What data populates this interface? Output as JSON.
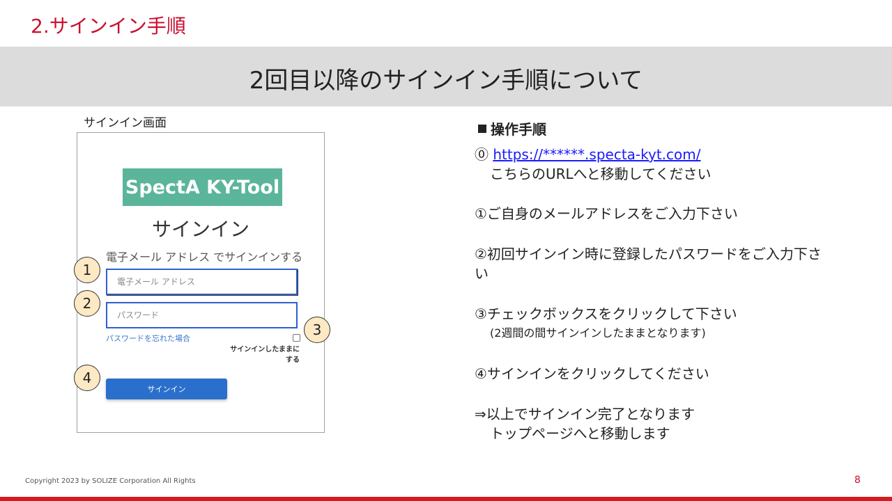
{
  "section_title": "2.サインイン手順",
  "banner_title": "2回目以降のサインイン手順について",
  "screen": {
    "caption": "サインイン画面",
    "logo_text": "SpectA KY-Tool",
    "heading": "サインイン",
    "subheading": "電子メール アドレス でサインインする",
    "email_placeholder": "電子メール アドレス",
    "password_placeholder": "パスワード",
    "forgot_link": "パスワードを忘れた場合",
    "stay_signed_in_line1": "サインインしたままに",
    "stay_signed_in_line2": "する",
    "signin_button": "サインイン"
  },
  "callouts": [
    "1",
    "2",
    "3",
    "4"
  ],
  "steps": {
    "heading": "操作手順",
    "step0_num": "⓪",
    "step0_url": "https://******.specta-kyt.com/",
    "step0_desc": "こちらのURLへと移動してください",
    "step1": "①ご自身のメールアドレスをご入力下さい",
    "step2_line1": "②初回サインイン時に登録したパスワードをご入力下さ",
    "step2_line2": "い",
    "step3": "③チェックボックスをクリックして下さい",
    "step3_note": "(2週間の間サインインしたままとなります)",
    "step4": "④サインインをクリックしてください",
    "result_line1": "⇒以上でサインイン完了となります",
    "result_line2": "トップページへと移動します"
  },
  "footer": {
    "copyright": "Copyright 2023 by SOLIZE Corporation All Rights",
    "page_number": "8"
  },
  "colors": {
    "accent_red": "#c8102e",
    "banner_gray": "#dcdcdc",
    "logo_green": "#5bb59a",
    "field_border": "#2f5fd0",
    "button_blue": "#2a6fcb",
    "callout_fill": "#fde9c4"
  }
}
